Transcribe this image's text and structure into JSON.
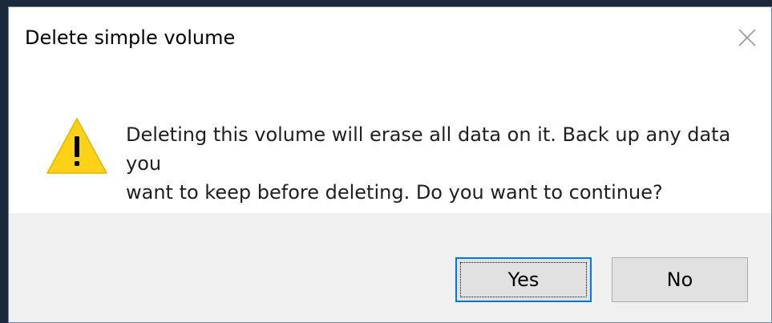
{
  "dialog": {
    "title": "Delete simple volume",
    "message_line1": "Deleting this volume will erase all data on it. Back up any data you",
    "message_line2": "want to keep before deleting. Do you want to continue?",
    "icon": "warning-icon",
    "close_icon": "close-icon"
  },
  "buttons": {
    "yes_label": "Yes",
    "no_label": "No"
  },
  "colors": {
    "accent": "#0078d7",
    "warning_fill": "#fcd116",
    "footer_bg": "#f0f0f0"
  }
}
